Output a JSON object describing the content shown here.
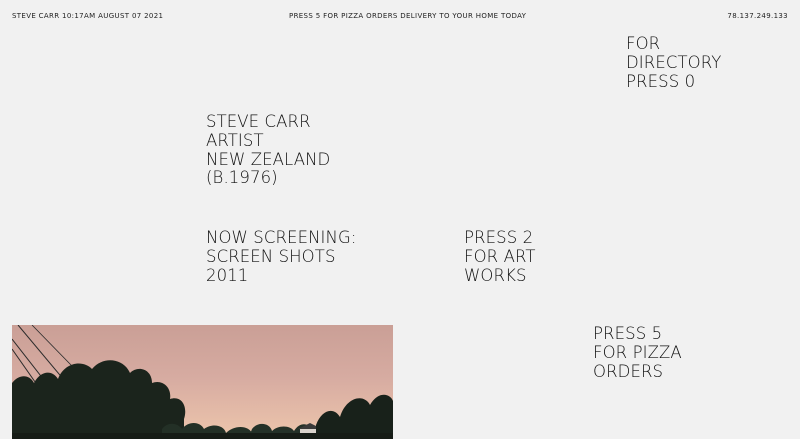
{
  "topbar": {
    "left_text": "STEVE CARR 10:17AM AUGUST 07 2021",
    "center_text": "PRESS 5 FOR PIZZA ORDERS DELIVERY TO YOUR HOME TODAY",
    "right_text": "78.137.249.133"
  },
  "directory": {
    "lines": [
      "FOR",
      "DIRECTORY",
      "PRESS 0"
    ]
  },
  "bio": {
    "lines": [
      "STEVE CARR",
      "ARTIST",
      "NEW ZEALAND",
      "(B.1976)"
    ]
  },
  "screening": {
    "lines": [
      "NOW SCREENING:",
      "SCREEN SHOTS",
      "2011"
    ]
  },
  "art": {
    "lines": [
      "PRESS 2",
      "FOR ART",
      "WORKS"
    ]
  },
  "pizza": {
    "lines": [
      "PRESS 5",
      "FOR PIZZA",
      "ORDERS"
    ]
  },
  "photo": {
    "icon": "photo-thumbnail"
  }
}
